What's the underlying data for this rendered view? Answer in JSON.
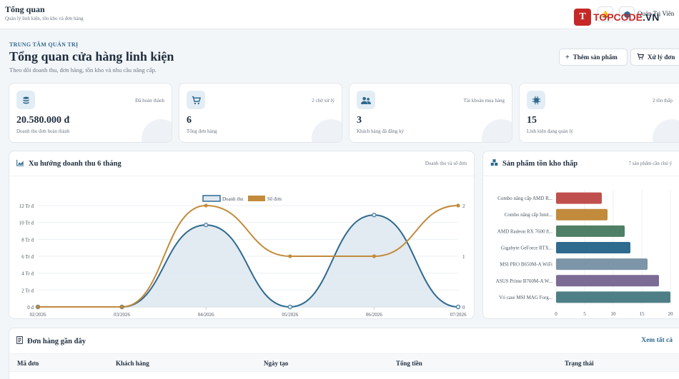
{
  "topbar": {
    "title": "Tổng quan",
    "subtitle": "Quản lý linh kiện, tồn kho và đơn hàng",
    "user_label": "Quản Trị Viên"
  },
  "logo": {
    "mark": "T",
    "word_main": "TOPCODE",
    "word_suffix": ".VN"
  },
  "header": {
    "eyebrow": "TRUNG TÂM QUẢN TRỊ",
    "title": "Tổng quan cửa hàng linh kiện",
    "subtitle": "Theo dõi doanh thu, đơn hàng, tồn kho và nhu cầu nâng cấp.",
    "add_product_label": "Thêm sản phẩm",
    "process_orders_label": "Xử lý đơn"
  },
  "stats": [
    {
      "icon": "coins-icon",
      "tag": "Đã hoàn thành",
      "value": "20.580.000 đ",
      "label": "Doanh thu đơn hoàn thành"
    },
    {
      "icon": "cart-icon",
      "tag": "2 chờ xử lý",
      "value": "6",
      "label": "Tổng đơn hàng"
    },
    {
      "icon": "users-icon",
      "tag": "Tài khoản mua hàng",
      "value": "3",
      "label": "Khách hàng đã đăng ký"
    },
    {
      "icon": "chip-icon",
      "tag": "2 tồn thấp",
      "value": "15",
      "label": "Linh kiện đang quản lý"
    }
  ],
  "revenue_panel": {
    "title": "Xu hướng doanh thu 6 tháng",
    "note": "Doanh thu và số đơn"
  },
  "stock_panel": {
    "title": "Sản phẩm tồn kho thấp",
    "note": "7 sản phẩm cần chú ý"
  },
  "orders_panel": {
    "title": "Đơn hàng gần đây",
    "see_all": "Xem tất cả",
    "columns": [
      "Mã đơn",
      "Khách hàng",
      "Ngày tạo",
      "Tổng tiền",
      "Trạng thái"
    ]
  },
  "colors": {
    "revenue": "#2f6a8f",
    "orders": "#c28b3c",
    "accent": "#2f6a8f"
  },
  "chart_data": [
    {
      "type": "line",
      "categories": [
        "02/2026",
        "03/2026",
        "04/2026",
        "05/2026",
        "06/2026",
        "07/2026"
      ],
      "series": [
        {
          "name": "Doanh thu",
          "axis": "left",
          "values": [
            0,
            0,
            9700000,
            0,
            10880000,
            0
          ]
        },
        {
          "name": "Số đơn",
          "axis": "right",
          "values": [
            0,
            0,
            2,
            1,
            1,
            2
          ]
        }
      ],
      "y_ticks": [
        "0 đ",
        "2 Tr đ",
        "4 Tr đ",
        "6 Tr đ",
        "8 Tr đ",
        "10 Tr đ",
        "12 Tr đ"
      ],
      "ylim": [
        0,
        12000000
      ],
      "y2_ticks": [
        "0",
        "1",
        "2"
      ],
      "y2lim": [
        0,
        2
      ],
      "legend": "top-center",
      "grid": true
    },
    {
      "type": "bar",
      "orientation": "horizontal",
      "categories": [
        "Combo nâng cấp AMD R...",
        "Combo nâng cấp Intel...",
        "AMD Radeon RX 7600 8...",
        "Gigabyte GeForce RTX...",
        "MSI PRO B650M-A WiFi",
        "ASUS Prime B760M-A W...",
        "Vỏ case MSI MAG Forg..."
      ],
      "values": [
        8,
        9,
        12,
        13,
        16,
        18,
        20
      ],
      "bar_colors": [
        "#c0504d",
        "#c28b3c",
        "#4f7f66",
        "#2f6a8f",
        "#7c95a8",
        "#7b6b95",
        "#4f7f86"
      ],
      "x_ticks": [
        "0",
        "5",
        "10",
        "15",
        "20"
      ],
      "xlim": [
        0,
        20
      ],
      "grid": true
    }
  ]
}
